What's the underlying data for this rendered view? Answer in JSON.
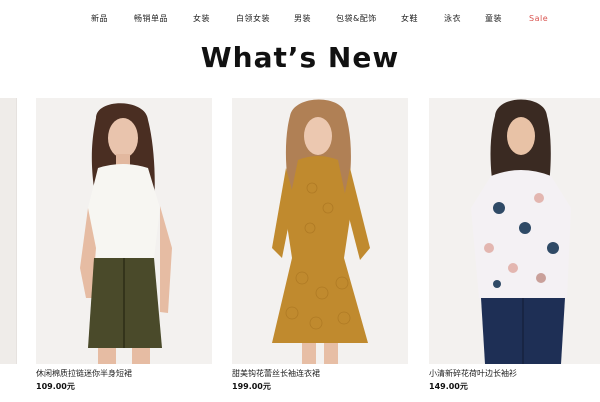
{
  "nav": {
    "items": [
      "新品",
      "畅销单品",
      "女装",
      "白领女装",
      "男装",
      "包袋&配饰",
      "女鞋",
      "泳衣",
      "童装",
      "Sale"
    ]
  },
  "heading": "What’s New",
  "products": [
    {
      "name": "休闲棉质拉链迷你半身短裙",
      "price": "109.00元"
    },
    {
      "name": "甜美钩花蕾丝长袖连衣裙",
      "price": "199.00元"
    },
    {
      "name": "小清新碎花荷叶边长袖衫",
      "price": "149.00元"
    }
  ],
  "colors": {
    "sale": "#d9534f",
    "skirt": "#4a4a2a",
    "dress": "#c08a2e",
    "floral_top": "#f4f1f4"
  }
}
